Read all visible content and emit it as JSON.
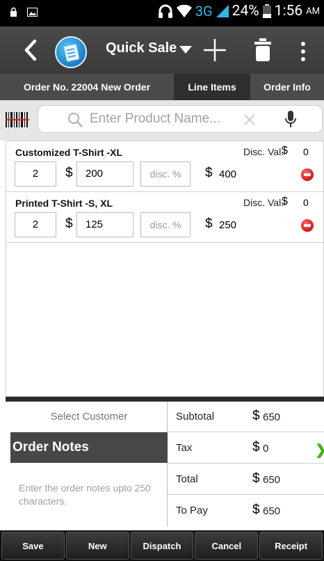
{
  "status_bar": {
    "network": "3G",
    "battery": "24%",
    "time": "1:56",
    "ampm": "AM"
  },
  "action_bar": {
    "title": "Quick Sale",
    "icons": [
      "back-icon",
      "app-logo",
      "dropdown-caret-icon",
      "plus-icon",
      "trash-icon",
      "overflow-menu-icon"
    ]
  },
  "tabs": [
    {
      "label": "Order No. 22004 New Order"
    },
    {
      "label": "Line Items"
    },
    {
      "label": "Order Info"
    }
  ],
  "search": {
    "placeholder": "Enter Product Name..."
  },
  "line_items": [
    {
      "name": "Customized T-Shirt -XL",
      "disc_label": "Disc. Val.",
      "currency": "$",
      "disc_value": "0",
      "qty": "2",
      "price": "200",
      "disc_placeholder": "disc. %",
      "total": "400"
    },
    {
      "name": "Printed T-Shirt -S, XL",
      "disc_label": "Disc. Val.",
      "currency": "$",
      "disc_value": "0",
      "qty": "2",
      "price": "125",
      "disc_placeholder": "disc. %",
      "total": "250"
    }
  ],
  "customer": {
    "select_label": "Select Customer"
  },
  "notes": {
    "header": "Order Notes",
    "placeholder": "Enter the order notes upto 250 characters."
  },
  "summary": {
    "currency": "$",
    "rows": [
      {
        "label": "Subtotal",
        "value": "650"
      },
      {
        "label": "Tax",
        "value": "0"
      },
      {
        "label": "Total",
        "value": "650"
      },
      {
        "label": "To Pay",
        "value": "650"
      }
    ]
  },
  "footer": {
    "buttons": [
      "Save",
      "New",
      "Dispatch",
      "Cancel",
      "Receipt"
    ]
  },
  "colors": {
    "action_bar": "#3f3f3f",
    "accent_3g": "#33b5e5",
    "remove": "#d10f0f",
    "chevron": "#3fb316"
  }
}
